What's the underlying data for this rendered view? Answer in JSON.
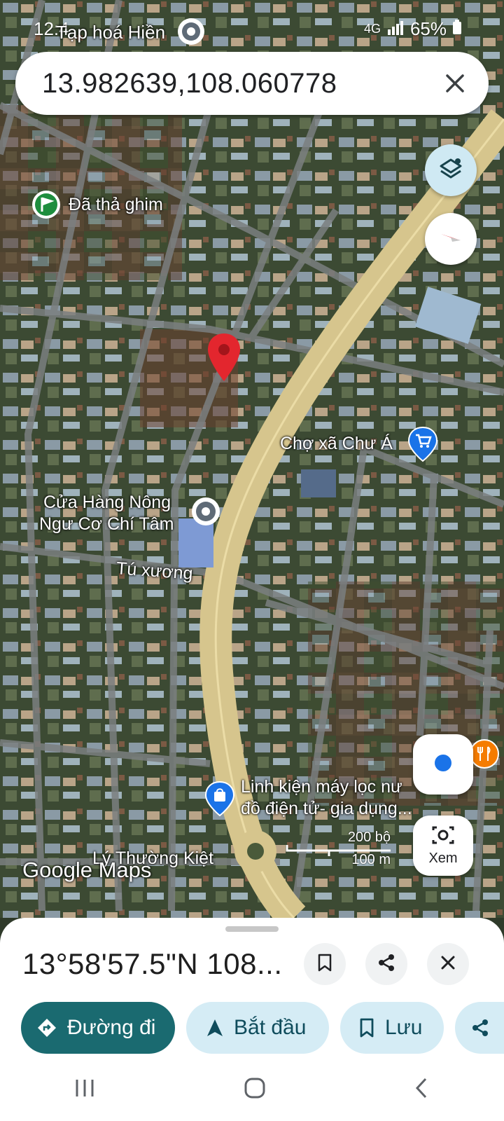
{
  "status_bar": {
    "time": "12:4",
    "right_text": "65%",
    "network": "4G"
  },
  "search": {
    "value": "13.982639,108.060778",
    "top_place": "Tạp hoá Hiền"
  },
  "map": {
    "labels": {
      "dropped_pin": "Đã thả ghim",
      "market": "Chợ xã Chư Á",
      "shop_line1": "Cửa Hàng Nông",
      "shop_line2": "Ngư Cơ Chí Tâm",
      "street_tu_xuong": "Tú xương",
      "electronics_line1": "Linh kiện máy lọc nư",
      "electronics_line2": "đồ điện tử- gia dụng...",
      "street_ly_thuong_kiet": "Lý Thường Kiệt",
      "watermark": "Google Maps",
      "scale_top": "200 bộ",
      "scale_bottom": "100 m",
      "lens_label": "Xem"
    }
  },
  "sheet": {
    "coordinates": "13°58'57.5\"N 108...",
    "actions": {
      "directions": "Đường đi",
      "start": "Bắt đầu",
      "save": "Lưu"
    }
  },
  "colors": {
    "accent_dark_teal": "#1a6a70",
    "chip_bg": "#d5ecf5",
    "chip_text": "#0f4c5c",
    "pin_red": "#e3262e",
    "road_main": "#d6c58d"
  },
  "icons": [
    "place-icon",
    "close-icon",
    "layers-icon",
    "compass-icon",
    "flag-pin-icon",
    "map-pin-icon",
    "shopping-cart-icon",
    "shopping-bag-icon",
    "restaurant-icon",
    "my-location-icon",
    "lens-icon",
    "bookmark-icon",
    "share-icon",
    "directions-icon",
    "navigation-arrow-icon"
  ]
}
